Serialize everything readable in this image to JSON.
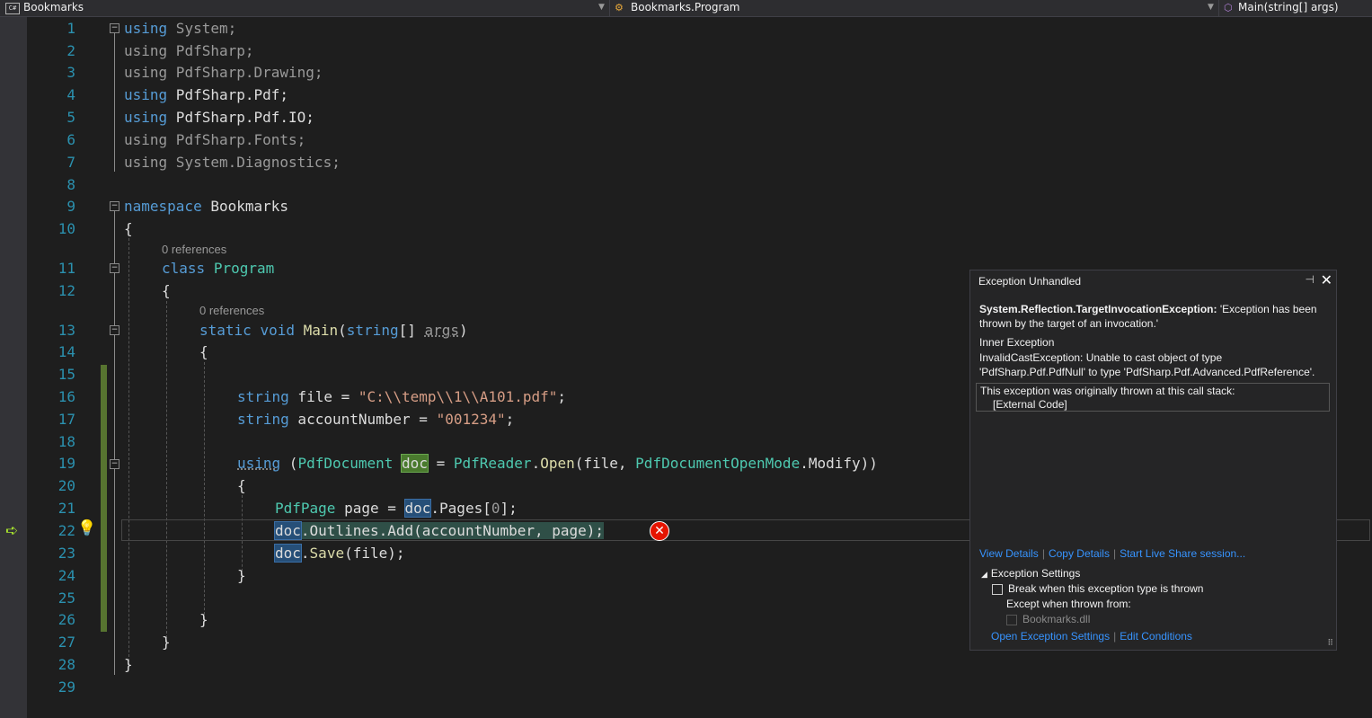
{
  "nav": {
    "project": "Bookmarks",
    "class": "Bookmarks.Program",
    "member": "Main(string[] args)",
    "project_icon_text": "C#"
  },
  "editor": {
    "codelens": [
      "0 references",
      "0 references"
    ],
    "line_numbers": [
      "1",
      "2",
      "3",
      "4",
      "5",
      "6",
      "7",
      "8",
      "9",
      "10",
      "11",
      "12",
      "13",
      "14",
      "15",
      "16",
      "17",
      "18",
      "19",
      "20",
      "21",
      "22",
      "23",
      "24",
      "25",
      "26",
      "27",
      "28",
      "29"
    ],
    "lines": {
      "l1": [
        "using",
        " System;"
      ],
      "l2": [
        "using",
        " PdfSharp;"
      ],
      "l3": [
        "using",
        " PdfSharp.Drawing;"
      ],
      "l4": [
        "using",
        " PdfSharp.Pdf;"
      ],
      "l5": [
        "using",
        " PdfSharp.Pdf.IO;"
      ],
      "l6": [
        "using",
        " PdfSharp.Fonts;"
      ],
      "l7": [
        "using",
        " System.Diagnostics;"
      ],
      "l9": [
        "namespace",
        " Bookmarks"
      ],
      "l10": [
        "{"
      ],
      "l11": [
        "class",
        " ",
        "Program"
      ],
      "l12": [
        "{"
      ],
      "l13": [
        "static",
        " ",
        "void",
        " ",
        "Main",
        "(",
        "string",
        "[] ",
        "args",
        ")"
      ],
      "l14": [
        "{"
      ],
      "l16": [
        "string",
        " file = ",
        "\"C:\\\\temp\\\\1\\\\A101.pdf\"",
        ";"
      ],
      "l17": [
        "string",
        " accountNumber = ",
        "\"001234\"",
        ";"
      ],
      "l19": [
        "using",
        " (",
        "PdfDocument",
        " ",
        "doc",
        " = ",
        "PdfReader",
        ".",
        "Open",
        "(file, ",
        "PdfDocumentOpenMode",
        ".Modify))"
      ],
      "l20": [
        "{"
      ],
      "l21": [
        "PdfPage",
        " page = ",
        "doc",
        ".Pages[",
        "0",
        "];"
      ],
      "l22": [
        "doc",
        ".Outlines.",
        "Add",
        "(accountNumber, page);"
      ],
      "l23": [
        "doc",
        ".",
        "Save",
        "(file);"
      ],
      "l24": [
        "}"
      ],
      "l26": [
        "}"
      ],
      "l27": [
        "}"
      ],
      "l28": [
        "}"
      ]
    }
  },
  "exception": {
    "title": "Exception Unhandled",
    "type": "System.Reflection.TargetInvocationException:",
    "message": " 'Exception has been thrown by the target of an invocation.'",
    "inner_heading": "Inner Exception",
    "inner_text": "InvalidCastException: Unable to cast object of type 'PdfSharp.Pdf.PdfNull' to type 'PdfSharp.Pdf.Advanced.PdfReference'.",
    "stack_heading": "This exception was originally thrown at this call stack:",
    "stack_frame": "[External Code]",
    "links": [
      "View Details",
      "Copy Details",
      "Start Live Share session..."
    ],
    "settings_heading": "Exception Settings",
    "break_label": "Break when this exception type is thrown",
    "except_when": "Except when thrown from:",
    "dll": "Bookmarks.dll",
    "links2": [
      "Open Exception Settings",
      "Edit Conditions"
    ]
  }
}
